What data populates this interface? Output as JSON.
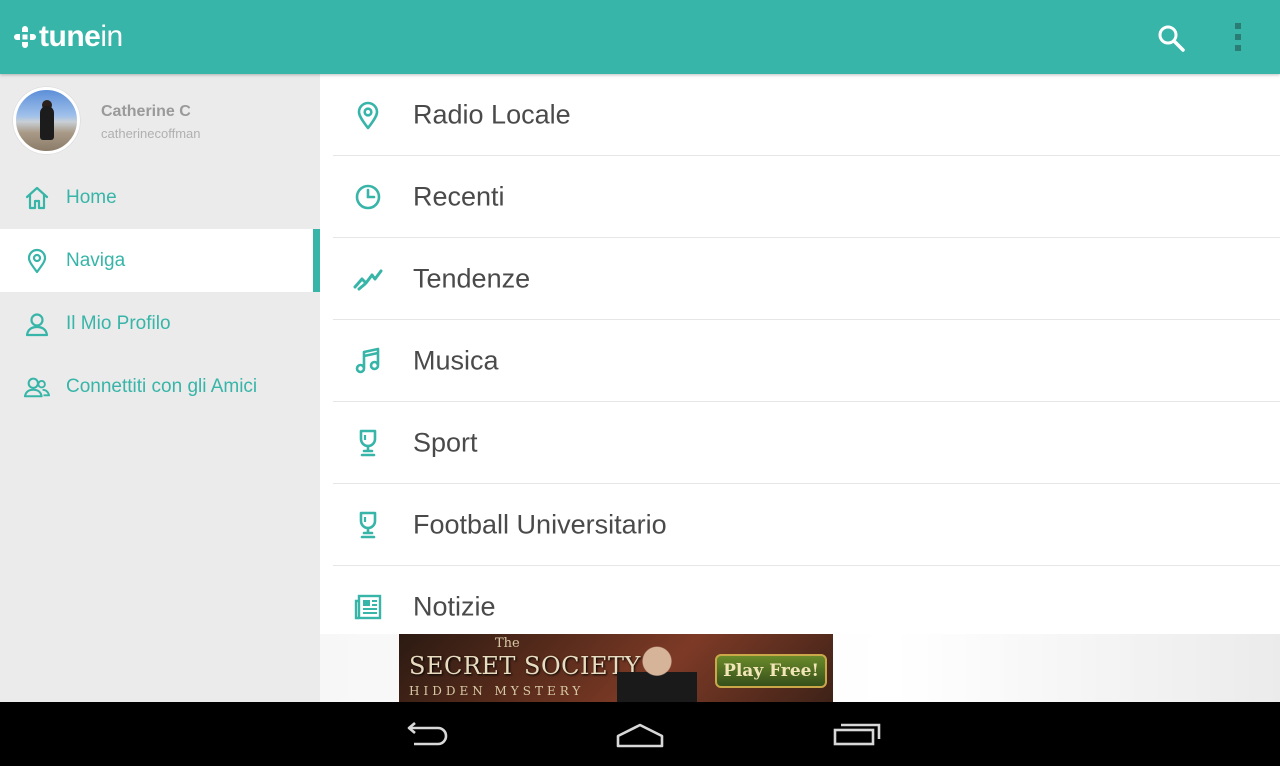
{
  "app": {
    "logo_tune": "tune",
    "logo_in": "in",
    "icons": {
      "search": "search-icon",
      "more": "more-vert-icon"
    },
    "accent_color": "#37b5a8"
  },
  "profile": {
    "name": "Catherine C",
    "username": "catherinecoffman"
  },
  "sidebar": {
    "items": [
      {
        "label": "Home",
        "icon": "home-icon"
      },
      {
        "label": "Naviga",
        "icon": "location-pin-icon",
        "active": true
      },
      {
        "label": "Il Mio Profilo",
        "icon": "person-icon"
      },
      {
        "label": "Connettiti con gli Amici",
        "icon": "friends-icon"
      }
    ]
  },
  "browse": {
    "items": [
      {
        "label": "Radio Locale",
        "icon": "location-pin-icon"
      },
      {
        "label": "Recenti",
        "icon": "clock-icon"
      },
      {
        "label": "Tendenze",
        "icon": "trending-icon"
      },
      {
        "label": "Musica",
        "icon": "music-note-icon"
      },
      {
        "label": "Sport",
        "icon": "trophy-icon"
      },
      {
        "label": "Football Universitario",
        "icon": "trophy-icon"
      },
      {
        "label": "Notizie",
        "icon": "newspaper-icon"
      }
    ]
  },
  "ad": {
    "small": "The",
    "title": "SECRET SOCIETY",
    "subtitle": "HIDDEN MYSTERY",
    "button": "Play Free!"
  },
  "system_nav": {
    "icons": [
      "back-icon",
      "home-outline-icon",
      "recent-apps-icon"
    ]
  }
}
